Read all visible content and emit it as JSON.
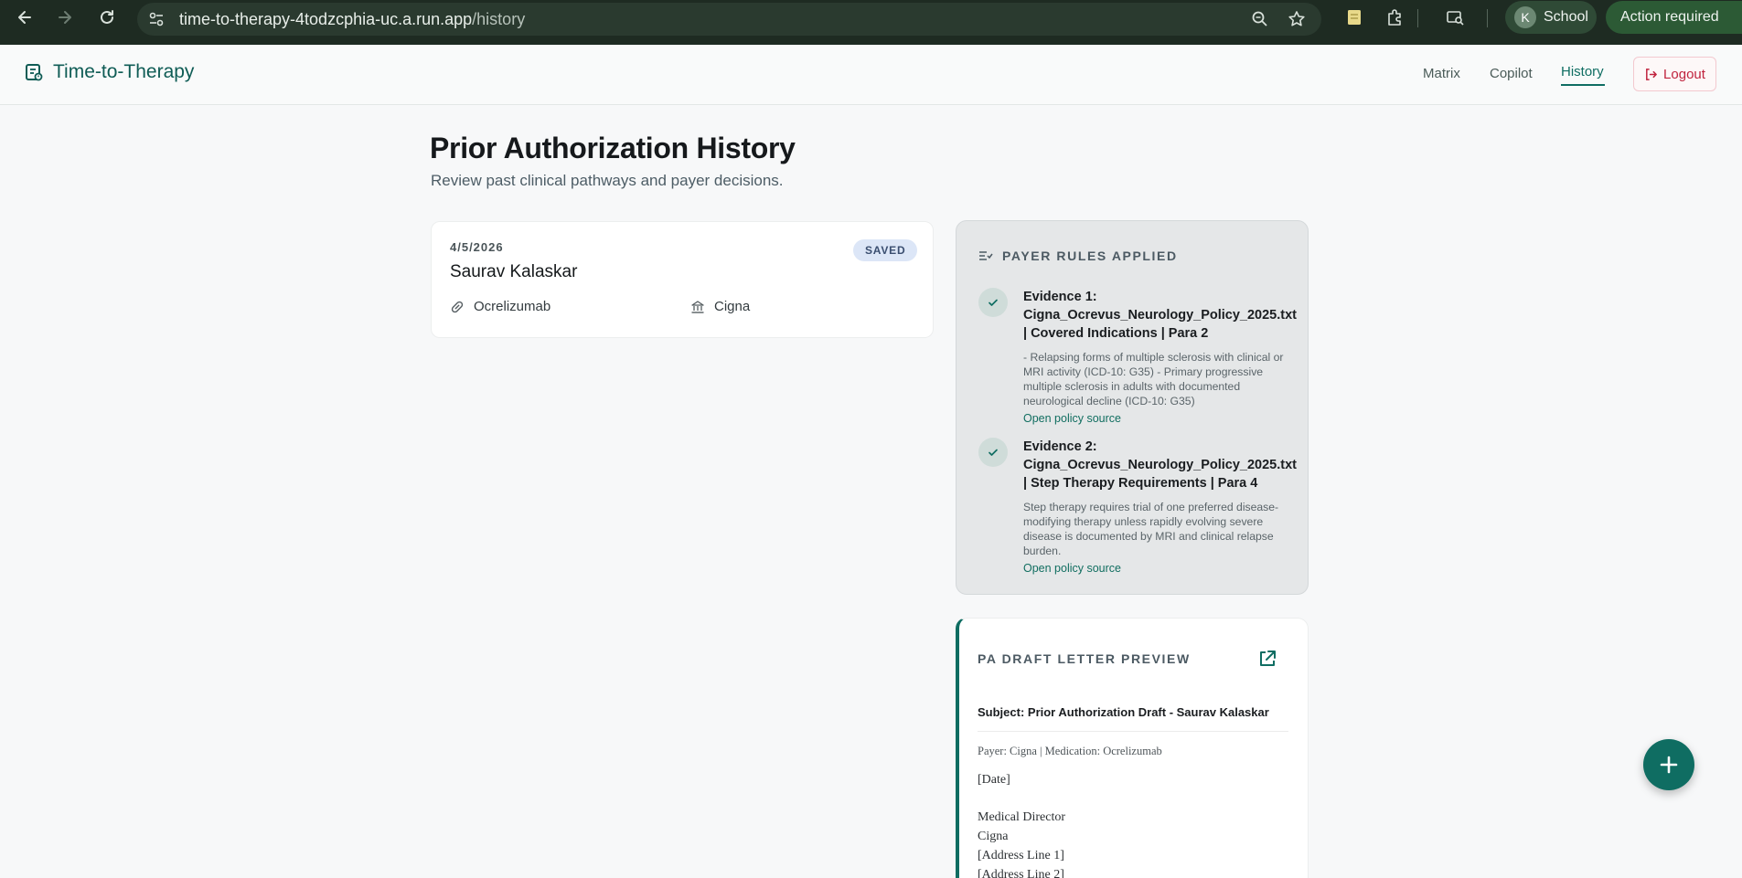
{
  "browser": {
    "url_host": "time-to-therapy-4todzcphia-uc.a.run.app",
    "url_path": "/history",
    "profile_initial": "K",
    "profile_label": "School",
    "action_label": "Action required"
  },
  "header": {
    "brand": "Time-to-Therapy",
    "nav": [
      "Matrix",
      "Copilot",
      "History"
    ],
    "active_nav": "History",
    "logout_label": "Logout"
  },
  "page": {
    "title": "Prior Authorization History",
    "subtitle": "Review past clinical pathways and payer decisions."
  },
  "history_card": {
    "date": "4/5/2026",
    "patient": "Saurav Kalaskar",
    "status": "SAVED",
    "medication": "Ocrelizumab",
    "payer": "Cigna"
  },
  "payer_rules": {
    "heading": "PAYER RULES APPLIED",
    "evidence": [
      {
        "title": "Evidence 1: Cigna_Ocrevus_Neurology_Policy_2025.txt | Covered Indications | Para 2",
        "text": "- Relapsing forms of multiple sclerosis with clinical or MRI activity (ICD-10: G35) - Primary progressive multiple sclerosis in adults with documented neurological decline (ICD-10: G35)",
        "link": "Open policy source"
      },
      {
        "title": "Evidence 2: Cigna_Ocrevus_Neurology_Policy_2025.txt | Step Therapy Requirements | Para 4",
        "text": "Step therapy requires trial of one preferred disease-modifying therapy unless rapidly evolving severe disease is documented by MRI and clinical relapse burden.",
        "link": "Open policy source"
      }
    ]
  },
  "letter": {
    "heading": "PA DRAFT LETTER PREVIEW",
    "subject": "Subject: Prior Authorization Draft - Saurav Kalaskar",
    "meta_line": "Payer: Cigna | Medication: Ocrelizumab",
    "date_line": "[Date]",
    "recipient_lines": [
      "Medical Director",
      "Cigna",
      "[Address Line 1]",
      "[Address Line 2]"
    ]
  },
  "colors": {
    "brand": "#0f5c55",
    "accent": "#0f6d62",
    "logout": "#c0233e",
    "chrome": "#1e2b22"
  }
}
